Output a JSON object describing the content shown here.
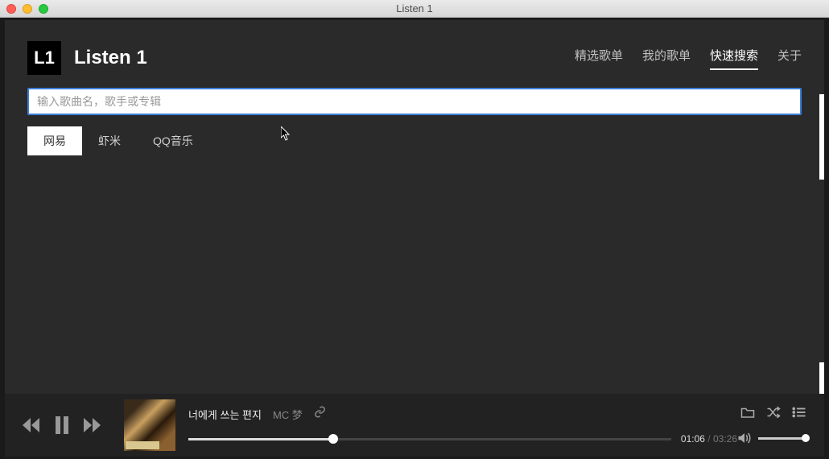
{
  "window": {
    "title": "Listen 1"
  },
  "header": {
    "logo_text": "L1",
    "app_title": "Listen 1"
  },
  "nav": {
    "items": [
      {
        "label": "精选歌单",
        "active": false
      },
      {
        "label": "我的歌单",
        "active": false
      },
      {
        "label": "快速搜索",
        "active": true
      },
      {
        "label": "关于",
        "active": false
      }
    ]
  },
  "search": {
    "placeholder": "输入歌曲名，歌手或专辑",
    "value": ""
  },
  "tabs": {
    "items": [
      {
        "label": "网易",
        "active": true
      },
      {
        "label": "虾米",
        "active": false
      },
      {
        "label": "QQ音乐",
        "active": false
      }
    ]
  },
  "player": {
    "track_title": "너에게 쓰는 편지",
    "artist": "MC 梦",
    "current_time": "01:06",
    "duration": "03:26",
    "progress_pct": 30,
    "volume_pct": 100
  }
}
